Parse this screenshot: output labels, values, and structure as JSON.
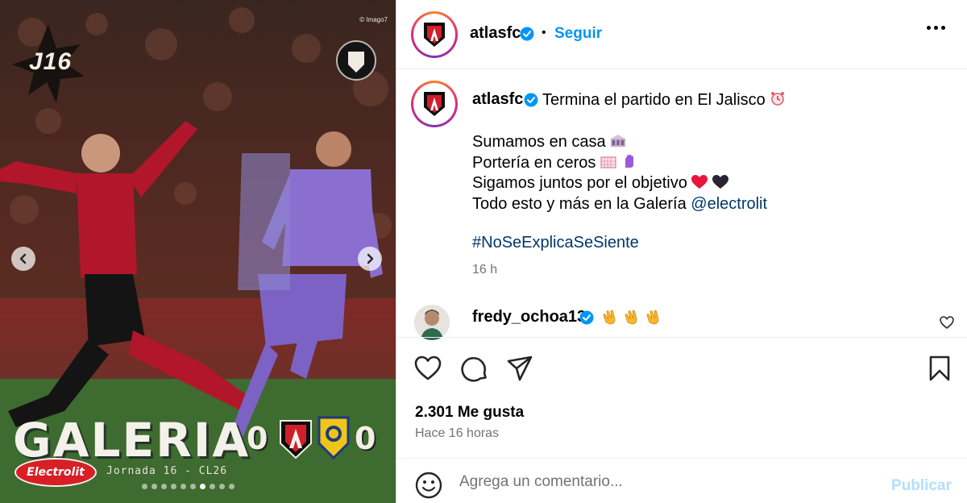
{
  "media": {
    "credit": "© Imago7",
    "badge": "J16",
    "headline": "GALERIA",
    "score_home": "0",
    "score_away": "0",
    "matchday": "Jornada 16 - CL26",
    "sponsor": "Electrolit",
    "slide_count": 10,
    "active_slide": 7
  },
  "header": {
    "username": "atlasfc",
    "separator": "•",
    "follow_label": "Seguir"
  },
  "caption": {
    "username": "atlasfc",
    "first_line": "Termina el partido en El Jalisco",
    "lines": [
      "Sumamos en casa",
      "Portería en ceros",
      "Sigamos juntos por el objetivo",
      "Todo esto y más en la Galería"
    ],
    "mention": "@electrolit",
    "hashtag": "#NoSeExplicaSeSiente",
    "time": "16 h"
  },
  "comment": {
    "username": "fredy_ochoa13"
  },
  "stats": {
    "likes": "2.301 Me gusta",
    "time_ago": "Hace 16 horas"
  },
  "composer": {
    "placeholder": "Agrega un comentario...",
    "publish_label": "Publicar"
  },
  "colors": {
    "link_blue": "#0095f6",
    "hashtag_blue": "#00376b",
    "verified_blue": "#0095f6",
    "publish_disabled": "#b2dffc",
    "secondary_text": "#737373"
  }
}
